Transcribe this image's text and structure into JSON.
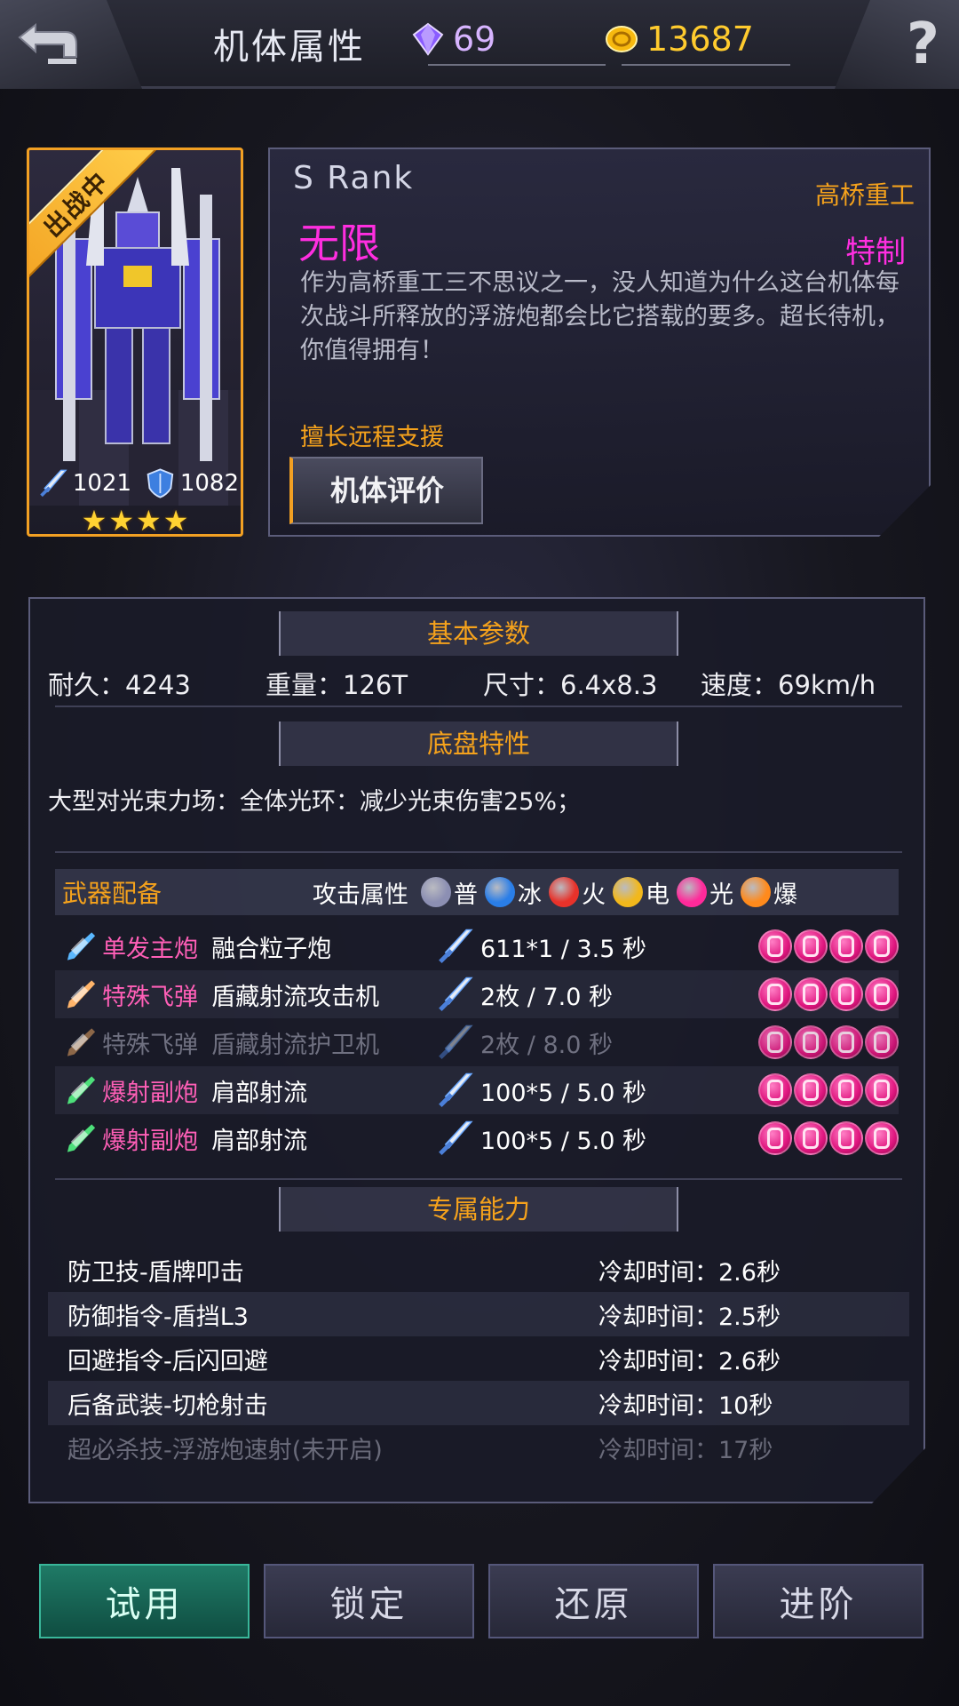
{
  "header": {
    "title": "机体属性",
    "gems": "69",
    "gold": "13687"
  },
  "unit": {
    "status_ribbon": "出战中",
    "attack": "1021",
    "defense": "1082",
    "stars": 4,
    "rank": "S  Rank",
    "maker": "高桥重工",
    "name": "无限",
    "tag": "特制",
    "description": "作为高桥重工三不思议之一，没人知道为什么这台机体每次战斗所释放的浮游炮都会比它搭载的要多。超长待机，你值得拥有！",
    "specialty": "擅长远程支援",
    "eval_button": "机体评价"
  },
  "basic": {
    "header": "基本参数",
    "durability": "耐久：4243",
    "weight": "重量：126T",
    "size": "尺寸：6.4x8.3",
    "speed": "速度：69km/h"
  },
  "chassis": {
    "header": "底盘特性",
    "text": "大型对光束力场：全体光环：减少光束伤害25%；"
  },
  "weapons": {
    "header": "武器配备",
    "attr_label": "攻击属性",
    "elements": [
      {
        "label": "普",
        "color": "#8c8fb3",
        "icon": "normal-icon"
      },
      {
        "label": "冰",
        "color": "#2a7ee8",
        "icon": "ice-icon"
      },
      {
        "label": "火",
        "color": "#e8322a",
        "icon": "fire-icon"
      },
      {
        "label": "电",
        "color": "#f2b81c",
        "icon": "electric-icon"
      },
      {
        "label": "光",
        "color": "#ff2a9a",
        "icon": "light-icon"
      },
      {
        "label": "爆",
        "color": "#ff8a1c",
        "icon": "explosive-icon"
      }
    ],
    "rows": [
      {
        "category": "单发主炮",
        "name": "融合粒子炮",
        "stat": "611*1 / 3.5 秒",
        "icon": "main-cannon-icon",
        "icon_color": "#5ab8ff",
        "dim": false
      },
      {
        "category": "特殊飞弹",
        "name": "盾藏射流攻击机",
        "stat": "2枚 / 7.0 秒",
        "icon": "missile-icon",
        "icon_color": "#ffb46a",
        "dim": false
      },
      {
        "category": "特殊飞弹",
        "name": "盾藏射流护卫机",
        "stat": "2枚 / 8.0 秒",
        "icon": "missile-icon",
        "icon_color": "#ffb46a",
        "dim": true
      },
      {
        "category": "爆射副炮",
        "name": "肩部射流",
        "stat": "100*5 / 5.0 秒",
        "icon": "sub-cannon-icon",
        "icon_color": "#4ddf7a",
        "dim": false
      },
      {
        "category": "爆射副炮",
        "name": "肩部射流",
        "stat": "100*5 / 5.0 秒",
        "icon": "sub-cannon-icon",
        "icon_color": "#4ddf7a",
        "dim": false
      }
    ]
  },
  "abilities": {
    "header": "专属能力",
    "rows": [
      {
        "name": "防卫技-盾牌叩击",
        "cooldown": "冷却时间：2.6秒",
        "dim": false
      },
      {
        "name": "防御指令-盾挡L3",
        "cooldown": "冷却时间：2.5秒",
        "dim": false
      },
      {
        "name": "回避指令-后闪回避",
        "cooldown": "冷却时间：2.6秒",
        "dim": false
      },
      {
        "name": "后备武装-切枪射击",
        "cooldown": "冷却时间：10秒",
        "dim": false
      },
      {
        "name": "超必杀技-浮游炮速射(未开启)",
        "cooldown": "冷却时间：17秒",
        "dim": true
      }
    ]
  },
  "buttons": {
    "trial": "试用",
    "lock": "锁定",
    "restore": "还原",
    "upgrade": "进阶"
  }
}
